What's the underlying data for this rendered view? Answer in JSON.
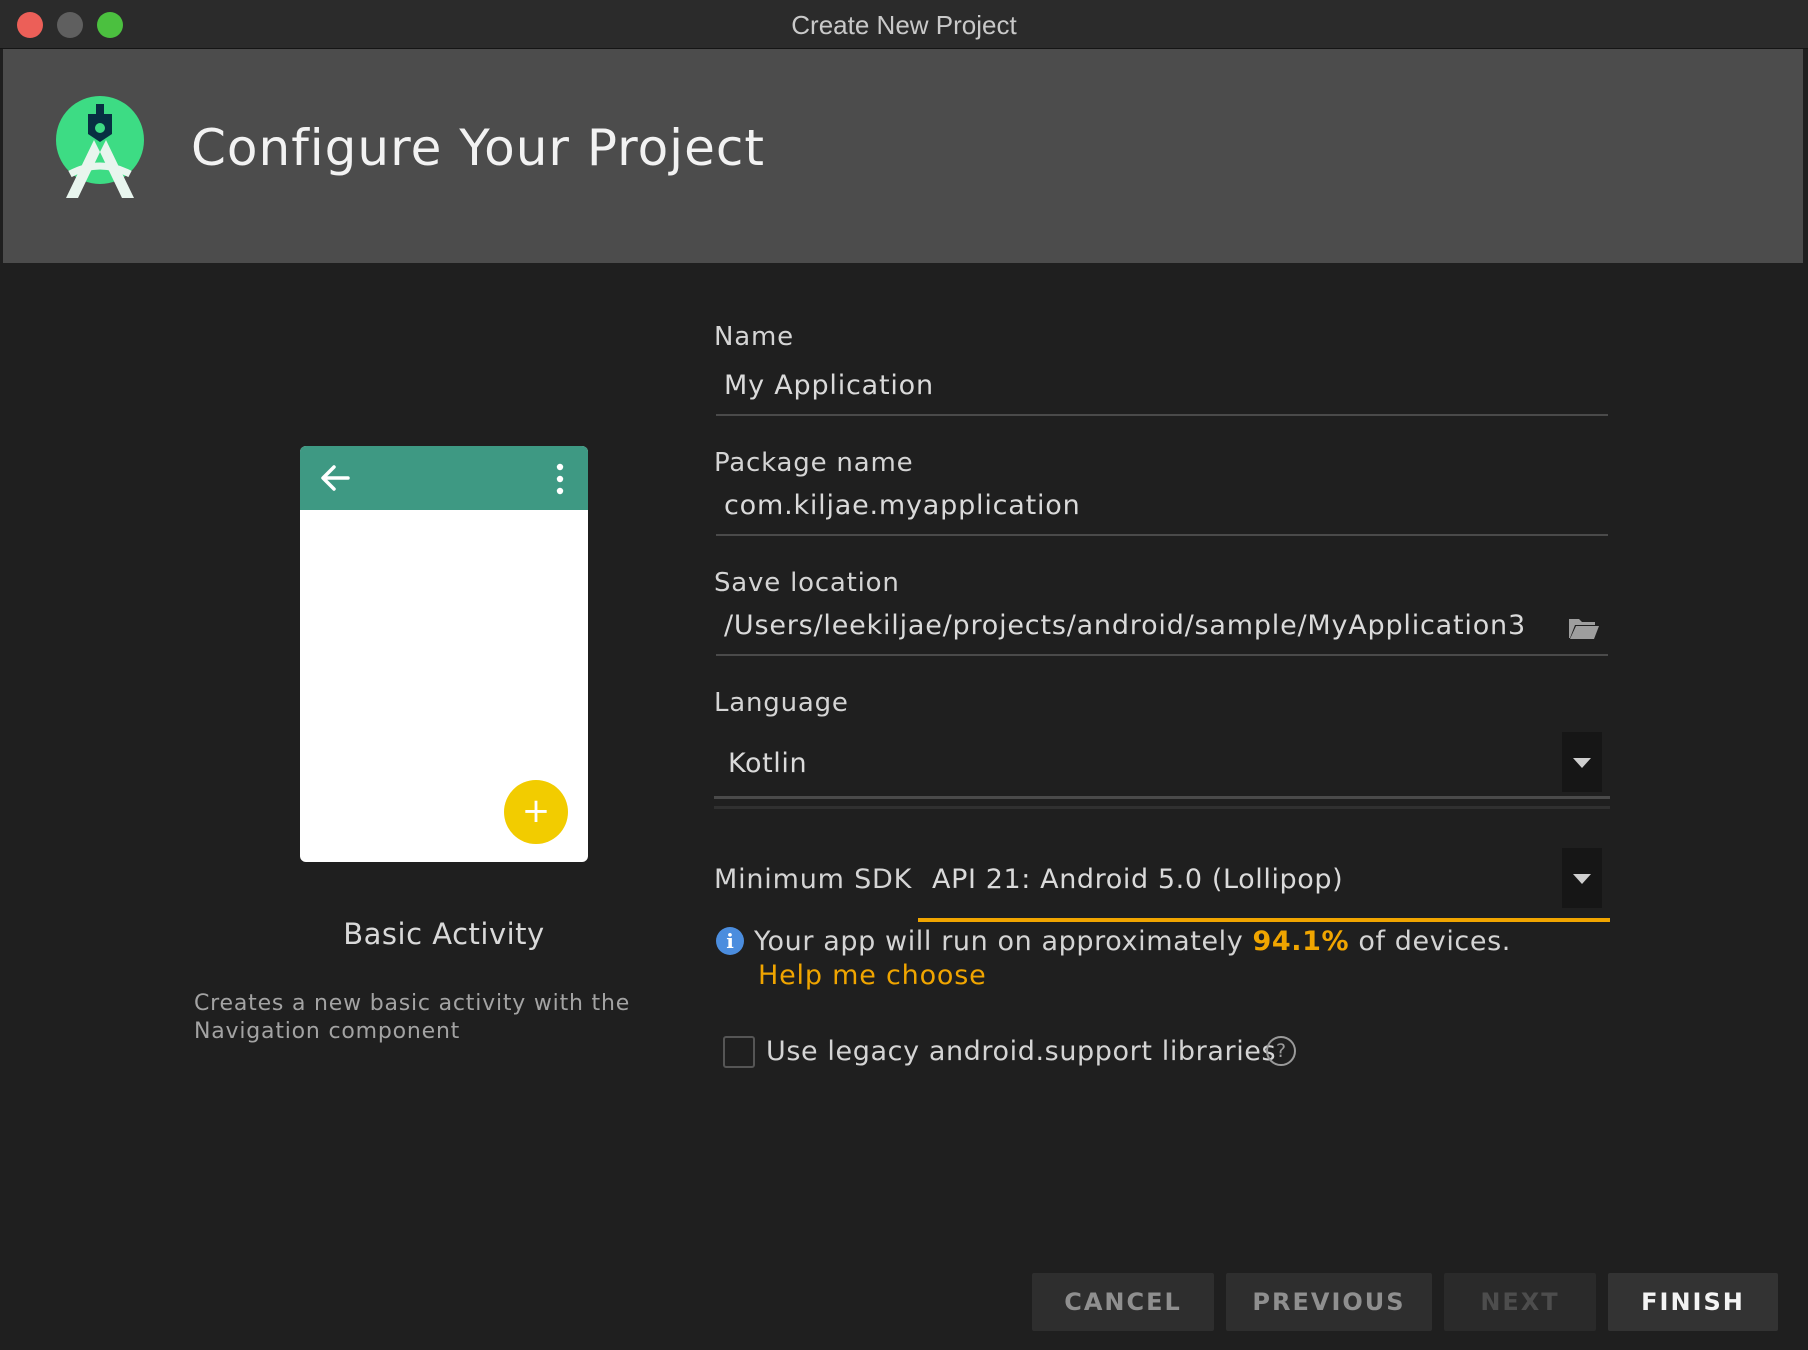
{
  "window": {
    "title": "Create New Project"
  },
  "header": {
    "title": "Configure Your Project",
    "logo_icon": "android-studio-logo-icon"
  },
  "template": {
    "name": "Basic Activity",
    "description": "Creates a new basic activity with the Navigation component",
    "fab_label": "+"
  },
  "form": {
    "name": {
      "label": "Name",
      "value": "My Application"
    },
    "package": {
      "label": "Package name",
      "value": "com.kiljae.myapplication"
    },
    "save_location": {
      "label": "Save location",
      "value": "/Users/leekiljae/projects/android/sample/MyApplication3"
    },
    "language": {
      "label": "Language",
      "value": "Kotlin"
    },
    "min_sdk": {
      "label": "Minimum SDK",
      "value": "API 21: Android 5.0 (Lollipop)"
    },
    "info": {
      "prefix": "Your app will run on approximately ",
      "percent": "94.1%",
      "suffix": " of devices.",
      "help_link": "Help me choose"
    },
    "legacy_checkbox": {
      "label": "Use legacy android.support libraries",
      "checked": false
    }
  },
  "buttons": {
    "cancel": "CANCEL",
    "previous": "PREVIOUS",
    "next": "NEXT",
    "finish": "FINISH"
  },
  "colors": {
    "accent": "#f0a500",
    "info_blue": "#4b8dde",
    "toolbar_teal": "#3e9983",
    "fab_yellow": "#f2cc00",
    "logo_green": "#3ddc84"
  }
}
